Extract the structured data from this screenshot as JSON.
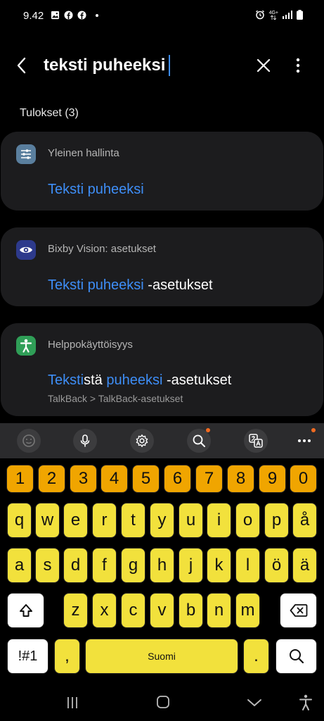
{
  "status_bar": {
    "time": "9.42",
    "network_label": "4G+"
  },
  "search": {
    "query": "teksti puheeksi"
  },
  "results_label": "Tulokset (3)",
  "results": [
    {
      "category": "Yleinen hallinta",
      "icon": "sliders-icon",
      "icon_bg": "#5a7f9e",
      "title_parts": [
        {
          "text": "Teksti puheeksi",
          "highlight": true
        }
      ]
    },
    {
      "category": "Bixby Vision: asetukset",
      "icon": "eye-icon",
      "icon_bg": "#2d3a8c",
      "title_parts": [
        {
          "text": "Teksti puheeksi",
          "highlight": true
        },
        {
          "text": " -asetukset",
          "highlight": false
        }
      ]
    },
    {
      "category": "Helppokäyttöisyys",
      "icon": "accessibility-icon",
      "icon_bg": "#2f9e57",
      "title_parts": [
        {
          "text": "Teksti",
          "highlight": true
        },
        {
          "text": "stä ",
          "highlight": false
        },
        {
          "text": "puheeksi",
          "highlight": true
        },
        {
          "text": " -asetukset",
          "highlight": false
        }
      ],
      "subtitle": "TalkBack > TalkBack-asetukset"
    }
  ],
  "keyboard": {
    "number_row": [
      "1",
      "2",
      "3",
      "4",
      "5",
      "6",
      "7",
      "8",
      "9",
      "0"
    ],
    "row1": [
      "q",
      "w",
      "e",
      "r",
      "t",
      "y",
      "u",
      "i",
      "o",
      "p",
      "å"
    ],
    "row2": [
      "a",
      "s",
      "d",
      "f",
      "g",
      "h",
      "j",
      "k",
      "l",
      "ö",
      "ä"
    ],
    "row3": [
      "z",
      "x",
      "c",
      "v",
      "b",
      "n",
      "m"
    ],
    "symbols_label": "!#1",
    "comma_label": ",",
    "space_label": "Suomi",
    "period_label": "."
  },
  "colors": {
    "accent": "#3e8ef7",
    "card_bg": "#1c1c1e",
    "key_number": "#f0a500",
    "key_letter": "#f2e13c",
    "notification_dot": "#f26b21"
  }
}
